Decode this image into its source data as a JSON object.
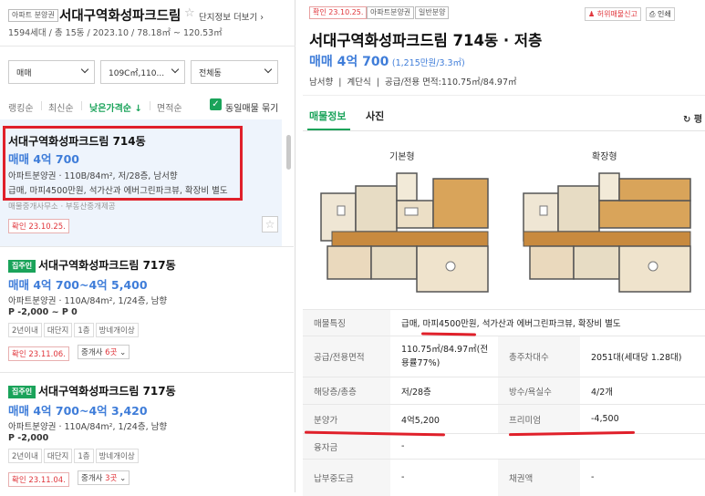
{
  "left": {
    "complex_tag": "아파트 분양권",
    "complex_title": "서대구역화성파크드림",
    "complex_info_link": "단지정보 더보기",
    "complex_meta": "1594세대 / 총 15동 / 2023.10 / 78.18㎡ ~ 120.53㎡",
    "filters": {
      "deal": "매매",
      "size": "109C㎡,110...",
      "dong": "전체동"
    },
    "sort": [
      "랭킹순",
      "최신순",
      "낮은가격순 ↓",
      "면적순"
    ],
    "same_listing_label": "동일매물 묶기",
    "cards": [
      {
        "title": "서대구역화성파크드림 714동",
        "price": "매매 4억 700",
        "line1": "아파트분양권 · 110B/84m², 저/28층, 남서향",
        "line2": "급매, 마피4500만원, 석가산과 에버그린파크뷰, 확장비 별도",
        "line3": "매물중개사무소 · 부동산중개제공",
        "confirm": "확인 23.10.25."
      },
      {
        "badge": "집주인",
        "title": "서대구역화성파크드림 717동",
        "price": "매매 4억 700~4억 5,400",
        "line1": "아파트분양권 · 110A/84m², 1/24층, 남향",
        "line2": "P -2,000 ~ P 0",
        "chips": [
          "2년이내",
          "대단지",
          "1층",
          "방네개이상"
        ],
        "confirm": "확인 23.11.06.",
        "agent_prefix": "중개사",
        "agent_count": "6곳"
      },
      {
        "badge": "집주인",
        "title": "서대구역화성파크드림 717동",
        "price": "매매 4억 700~4억 3,420",
        "line1": "아파트분양권 · 110A/84m², 1/24층, 남향",
        "line2": "P -2,000",
        "chips": [
          "2년이내",
          "대단지",
          "1층",
          "방네개이상"
        ],
        "confirm": "확인 23.11.04.",
        "agent_prefix": "중개사",
        "agent_count": "3곳"
      }
    ]
  },
  "right": {
    "tags": [
      "확인 23.10.25.",
      "아파트분양권",
      "일반분양"
    ],
    "report_btn": "허위매물신고",
    "print_btn": "인쇄",
    "title": "서대구역화성파크드림 714동 · 저층",
    "price": "매매 4억 700",
    "price_sub": "(1,215만원/3.3㎡)",
    "summary": "남서향  |  계단식  |  공급/전용 면적:110.75㎡/84.97㎡",
    "tabs": [
      "매물정보",
      "사진"
    ],
    "refresh": "평",
    "plans": [
      "기본형",
      "확장형"
    ],
    "rows": [
      {
        "l1": "매물특징",
        "v1": "급매, 마피4500만원, 석가산과 에버그린파크뷰, 확장비 별도"
      },
      {
        "l1": "공급/전용면적",
        "v1": "110.75㎡/84.97㎡(전용률77%)",
        "l2": "총주차대수",
        "v2": "2051대(세대당 1.28대)"
      },
      {
        "l1": "해당층/총층",
        "v1": "저/28층",
        "l2": "방수/욕실수",
        "v2": "4/2개"
      },
      {
        "l1": "분양가",
        "v1": "4억5,200",
        "l2": "프리미엄",
        "v2": "-4,500"
      },
      {
        "l1": "융자금",
        "v1": "-"
      },
      {
        "l1": "납부중도금",
        "v1": "-",
        "l2": "채권액",
        "v2": "-"
      }
    ]
  },
  "colors": {
    "accent_blue": "#3f7dd9",
    "accent_green": "#1aa35a",
    "highlight_red": "#e0202a"
  }
}
